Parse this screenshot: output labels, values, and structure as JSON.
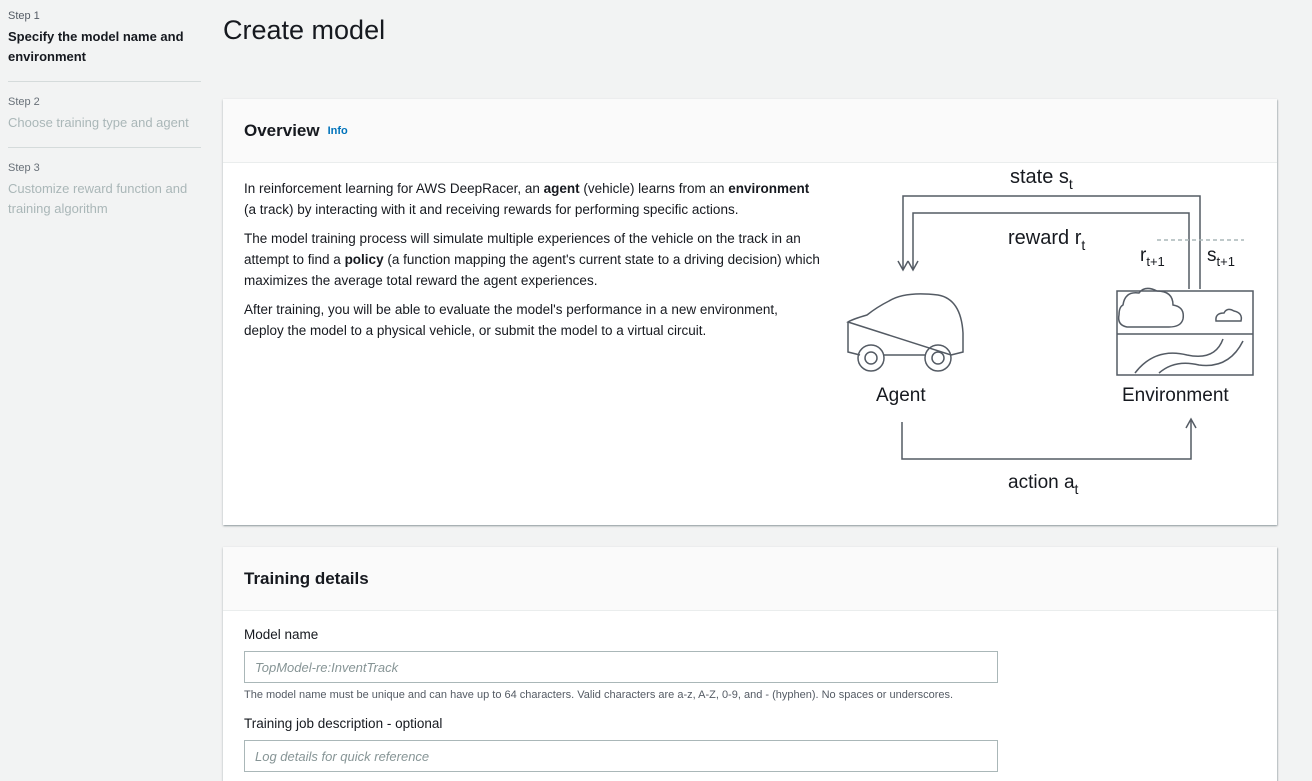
{
  "steps": [
    {
      "num": "Step 1",
      "title": "Specify the model name and environment"
    },
    {
      "num": "Step 2",
      "title": "Choose training type and agent"
    },
    {
      "num": "Step 3",
      "title": "Customize reward function and training algorithm"
    }
  ],
  "page_title": "Create model",
  "overview": {
    "title": "Overview",
    "info": "Info",
    "p1": {
      "a": "In reinforcement learning for AWS DeepRacer, an ",
      "b1": "agent",
      "c": " (vehicle) learns from an ",
      "b2": "environment",
      "d": " (a track) by interacting with it and receiving rewards for performing specific actions."
    },
    "p2": {
      "a": "The model training process will simulate multiple experiences of the vehicle on the track in an attempt to find a ",
      "b": "policy",
      "c": " (a function mapping the agent's current state to a driving decision) which maximizes the average total reward the agent experiences."
    },
    "p3": "After training, you will be able to evaluate the model's performance in a new environment, deploy the model to a physical vehicle, or submit the model to a virtual circuit."
  },
  "diagram": {
    "state": "state s",
    "state_sub": "t",
    "reward": "reward r",
    "reward_sub": "t",
    "r_next": "r",
    "r_next_sub": "t+1",
    "s_next": "s",
    "s_next_sub": "t+1",
    "agent": "Agent",
    "environment": "Environment",
    "action": "action a",
    "action_sub": "t"
  },
  "training": {
    "title": "Training details",
    "model_name_label": "Model name",
    "model_name_placeholder": "TopModel-re:InventTrack",
    "model_name_hint": "The model name must be unique and can have up to 64 characters. Valid characters are a-z, A-Z, 0-9, and - (hyphen). No spaces or underscores.",
    "description_label": "Training job description - optional",
    "description_placeholder": "Log details for quick reference"
  }
}
